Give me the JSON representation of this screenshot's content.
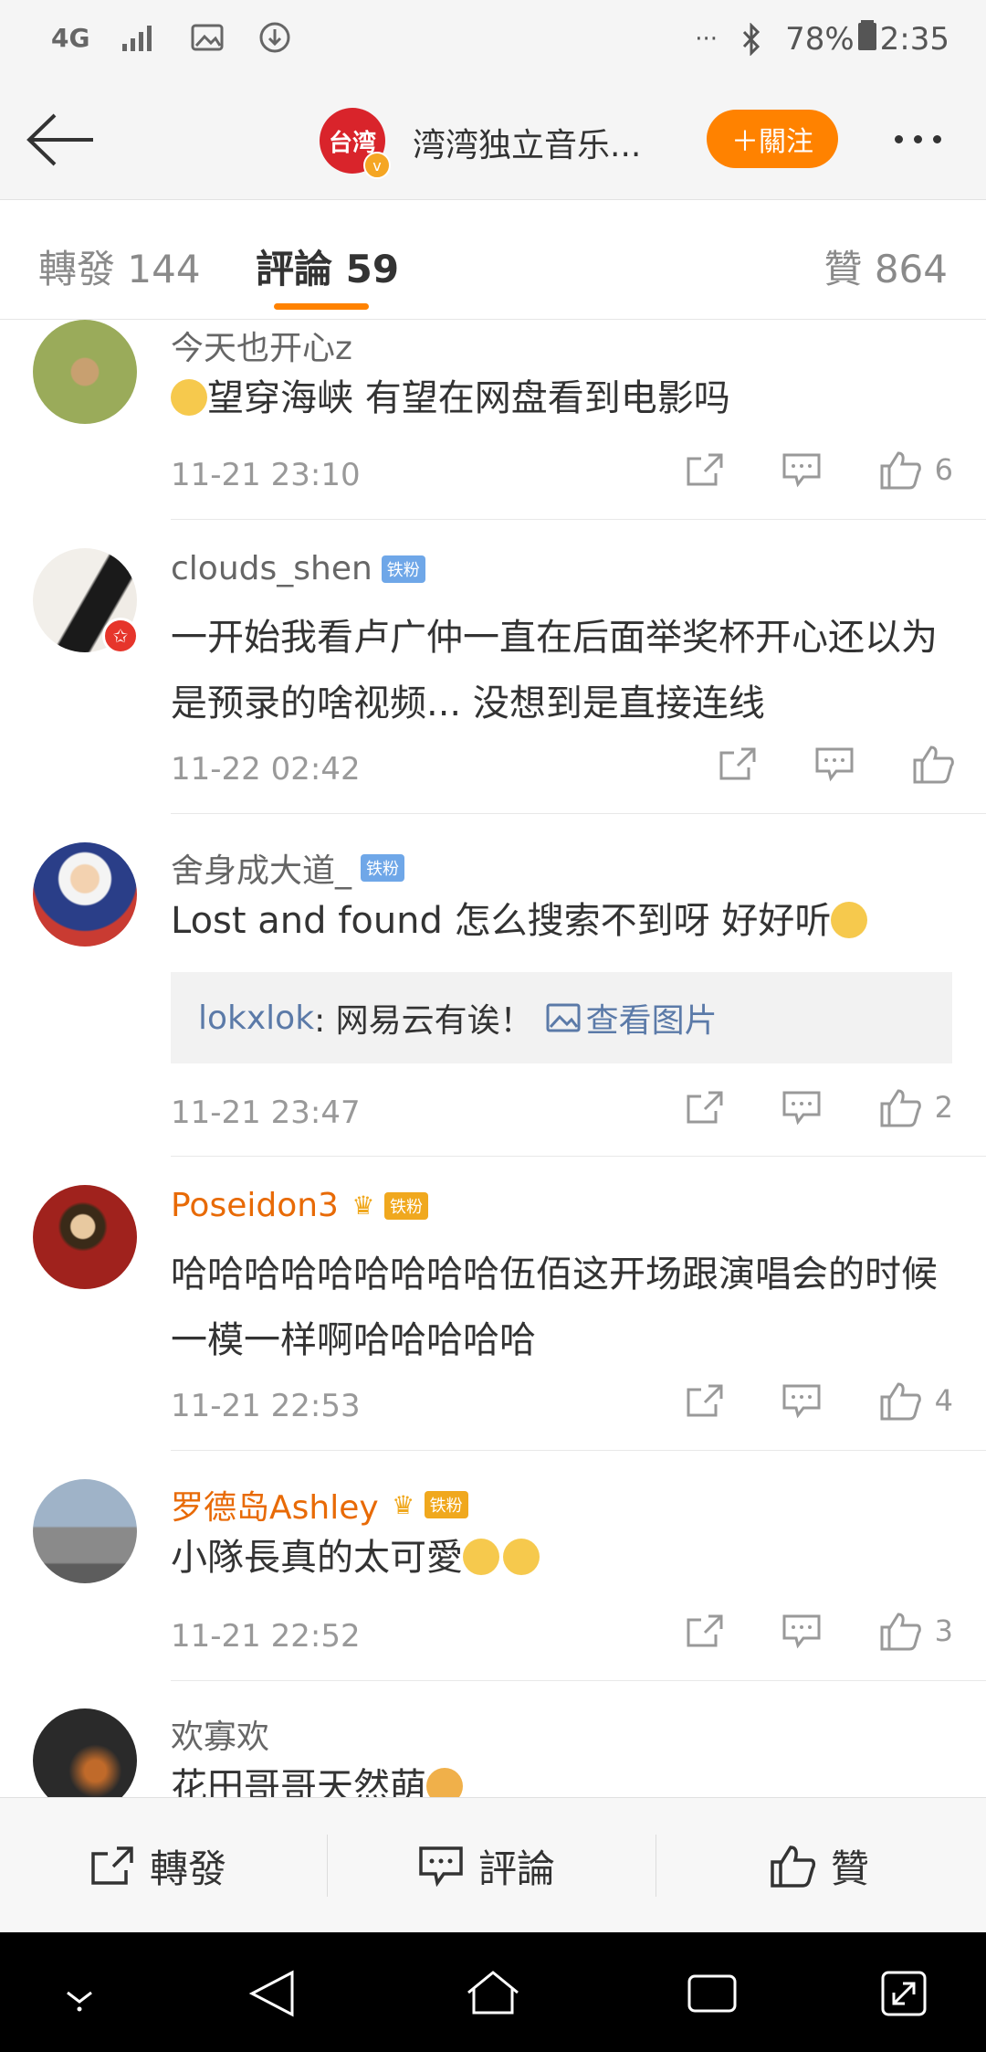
{
  "status_bar": {
    "network": "4G",
    "battery": "78%",
    "time": "2:35",
    "more": "···"
  },
  "header": {
    "logo_text": "台湾",
    "verified_mark": "v",
    "title": "湾湾独立音乐...",
    "follow_label": "＋關注"
  },
  "tabs": [
    {
      "label": "轉發",
      "count": "144"
    },
    {
      "label": "評論",
      "count": "59"
    },
    {
      "label": "贊",
      "count": "864"
    }
  ],
  "comments": [
    {
      "user": "今天也开心z",
      "text": "望穿海峡 有望在网盘看到电影吗",
      "time": "11-21 23:10",
      "likes": "6"
    },
    {
      "user": "clouds_shen",
      "badge": "铁粉",
      "text": "一开始我看卢广仲一直在后面举奖杯开心还以为是预录的啥视频... 没想到是直接连线",
      "time": "11-22 02:42",
      "likes": ""
    },
    {
      "user": "舍身成大道_",
      "badge": "铁粉",
      "text": "Lost and found 怎么搜索不到呀 好好听",
      "reply_user": "lokxlok",
      "reply_text": ": 网易云有诶！",
      "reply_link": "查看图片",
      "time": "11-21 23:47",
      "likes": "2"
    },
    {
      "user": "Poseidon3",
      "badge": "铁粉",
      "text": "哈哈哈哈哈哈哈哈哈伍佰这开场跟演唱会的时候一模一样啊哈哈哈哈哈",
      "time": "11-21 22:53",
      "likes": "4"
    },
    {
      "user": "罗德岛Ashley",
      "badge": "铁粉",
      "text": "小隊長真的太可愛",
      "time": "11-21 22:52",
      "likes": "3"
    },
    {
      "user": "欢寡欢",
      "text": "花田哥哥天然萌",
      "time": "",
      "likes": ""
    }
  ],
  "bottom_bar": {
    "repost": "轉發",
    "comment": "評論",
    "like": "贊"
  },
  "colors": {
    "accent": "#ff8200",
    "vip_name": "#e86a06",
    "fan_badge": "#6fa7e8",
    "link": "#5b7aa8"
  }
}
